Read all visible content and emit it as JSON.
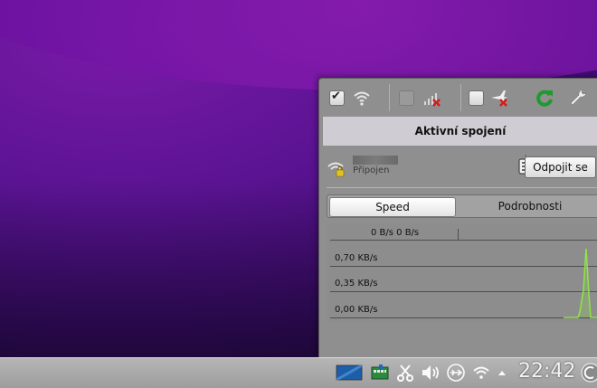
{
  "popup": {
    "header_title": "Aktivní spojení",
    "connection": {
      "status": "Připojen",
      "disconnect_label": "Odpojit se"
    },
    "tabs": [
      {
        "label": "Speed",
        "active": true
      },
      {
        "label": "Podrobnosti",
        "active": false
      }
    ],
    "graph": {
      "speed_readout": "0 B/s 0 B/s",
      "tick_labels": [
        "0,70 KB/s",
        "0,35 KB/s",
        "0,00 KB/s"
      ],
      "line_color": "#8fe04a"
    },
    "toolbar": {
      "wifi_checked": true,
      "mobile_checked": false,
      "airplane_checked": false
    }
  },
  "taskbar": {
    "clock": "22:42"
  }
}
